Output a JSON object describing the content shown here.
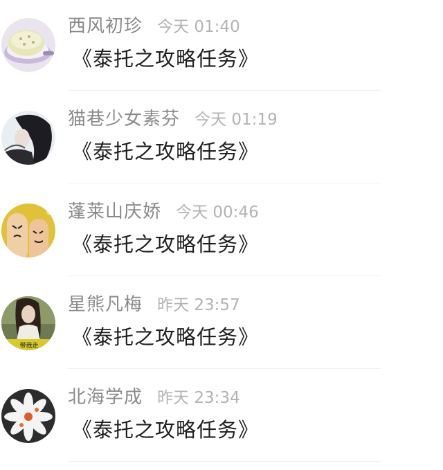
{
  "comments": [
    {
      "name": "西风初珍",
      "time": "今天 01:40",
      "message": "《泰托之攻略任务》",
      "avatar_icon": "cake-avatar-icon"
    },
    {
      "name": "猫巷少女素芬",
      "time": "今天 01:19",
      "message": "《泰托之攻略任务》",
      "avatar_icon": "girl-portrait-avatar-icon"
    },
    {
      "name": "蓬莱山庆娇",
      "time": "今天 00:46",
      "message": "《泰托之攻略任务》",
      "avatar_icon": "finger-faces-avatar-icon"
    },
    {
      "name": "星熊凡梅",
      "time": "昨天 23:57",
      "message": "《泰托之攻略任务》",
      "avatar_icon": "girl-photo-avatar-icon",
      "avatar_caption": "带我走"
    },
    {
      "name": "北海学成",
      "time": "昨天 23:34",
      "message": "《泰托之攻略任务》",
      "avatar_icon": "white-flower-avatar-icon"
    }
  ]
}
